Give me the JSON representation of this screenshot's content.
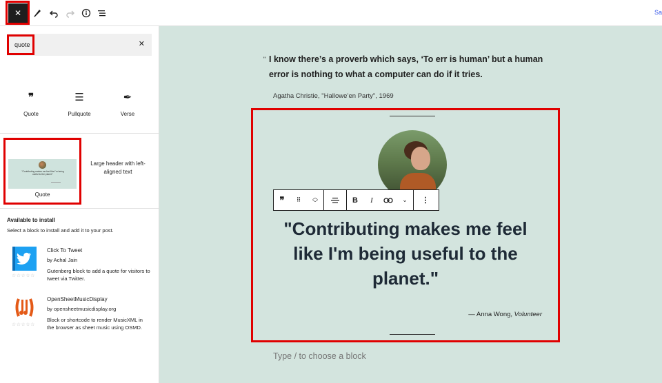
{
  "topbar": {
    "close_label": "✕",
    "save_stub": "Sa"
  },
  "search": {
    "value": "quote",
    "clear_label": "✕"
  },
  "block_results": [
    {
      "icon": "quote-icon",
      "label": "Quote",
      "glyph": "❞"
    },
    {
      "icon": "pullquote-icon",
      "label": "Pullquote",
      "glyph": "☰"
    },
    {
      "icon": "verse-icon",
      "label": "Verse",
      "glyph": "✒"
    }
  ],
  "patterns": [
    {
      "label": "Quote",
      "preview_text": "\"Contributing makes me feel like I'm being useful to the planet.\""
    },
    {
      "label": "Large header with left-aligned text"
    }
  ],
  "install": {
    "title": "Available to install",
    "subtitle": "Select a block to install and add it to your post.",
    "plugins": [
      {
        "name": "Click To Tweet",
        "by": "by Achal Jain",
        "description": "Gutenberg block to add a quote for visitors to tweet via Twitter.",
        "stars": "☆☆☆☆☆",
        "icon": "twitter-icon",
        "color": "#1da1f2"
      },
      {
        "name": "OpenSheetMusicDisplay",
        "by": "by opensheetmusicdisplay.org",
        "description": "Block or shortcode to render MusicXML in the browser as sheet music using OSMD.",
        "stars": "☆☆☆☆☆",
        "icon": "osmd-icon",
        "color": "#e45a17"
      }
    ]
  },
  "content": {
    "quote1_mark": "\"",
    "quote1_text": "I know there’s a proverb which says, ‘To err is human’ but a human error is nothing to what a computer can do if it tries.",
    "quote1_citation": "Agatha Christie, \"Hallowe’en Party\", 1969",
    "pullquote_text": "\"Contributing makes me feel like I'm being useful to the planet.\"",
    "pullquote_author": "— Anna Wong,",
    "pullquote_role": "Volunteer",
    "placeholder": "Type / to choose a block"
  },
  "colors": {
    "canvas_bg": "#d3e4de",
    "highlight": "#e00000"
  }
}
